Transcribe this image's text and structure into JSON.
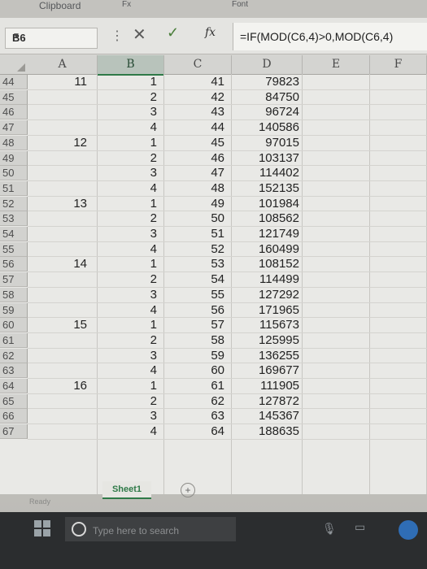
{
  "ribbon": {
    "clipboard_label": "Clipboard",
    "fx_group": "Fx",
    "font_group": "Font"
  },
  "formula_bar": {
    "name_box": "B6",
    "cancel_icon": "cancel-x-icon",
    "enter_icon": "check-icon",
    "fx_label": "fx",
    "formula": "=IF(MOD(C6,4)>0,MOD(C6,4)"
  },
  "columns": [
    "A",
    "B",
    "C",
    "D",
    "E",
    "F"
  ],
  "rows": [
    {
      "row": "44",
      "a": "11",
      "b": "1",
      "c": "41",
      "d": "79823"
    },
    {
      "row": "45",
      "a": "",
      "b": "2",
      "c": "42",
      "d": "84750"
    },
    {
      "row": "46",
      "a": "",
      "b": "3",
      "c": "43",
      "d": "96724"
    },
    {
      "row": "47",
      "a": "",
      "b": "4",
      "c": "44",
      "d": "140586"
    },
    {
      "row": "48",
      "a": "12",
      "b": "1",
      "c": "45",
      "d": "97015"
    },
    {
      "row": "49",
      "a": "",
      "b": "2",
      "c": "46",
      "d": "103137"
    },
    {
      "row": "50",
      "a": "",
      "b": "3",
      "c": "47",
      "d": "114402"
    },
    {
      "row": "51",
      "a": "",
      "b": "4",
      "c": "48",
      "d": "152135"
    },
    {
      "row": "52",
      "a": "13",
      "b": "1",
      "c": "49",
      "d": "101984"
    },
    {
      "row": "53",
      "a": "",
      "b": "2",
      "c": "50",
      "d": "108562"
    },
    {
      "row": "54",
      "a": "",
      "b": "3",
      "c": "51",
      "d": "121749"
    },
    {
      "row": "55",
      "a": "",
      "b": "4",
      "c": "52",
      "d": "160499"
    },
    {
      "row": "56",
      "a": "14",
      "b": "1",
      "c": "53",
      "d": "108152"
    },
    {
      "row": "57",
      "a": "",
      "b": "2",
      "c": "54",
      "d": "114499"
    },
    {
      "row": "58",
      "a": "",
      "b": "3",
      "c": "55",
      "d": "127292"
    },
    {
      "row": "59",
      "a": "",
      "b": "4",
      "c": "56",
      "d": "171965"
    },
    {
      "row": "60",
      "a": "15",
      "b": "1",
      "c": "57",
      "d": "115673"
    },
    {
      "row": "61",
      "a": "",
      "b": "2",
      "c": "58",
      "d": "125995"
    },
    {
      "row": "62",
      "a": "",
      "b": "3",
      "c": "59",
      "d": "136255"
    },
    {
      "row": "63",
      "a": "",
      "b": "4",
      "c": "60",
      "d": "169677"
    },
    {
      "row": "64",
      "a": "16",
      "b": "1",
      "c": "61",
      "d": "111905"
    },
    {
      "row": "65",
      "a": "",
      "b": "2",
      "c": "62",
      "d": "127872"
    },
    {
      "row": "66",
      "a": "",
      "b": "3",
      "c": "63",
      "d": "145367"
    },
    {
      "row": "67",
      "a": "",
      "b": "4",
      "c": "64",
      "d": "188635"
    }
  ],
  "sheet_tab": "Sheet1",
  "status": "Ready",
  "taskbar": {
    "search_placeholder": "Type here to search"
  },
  "colors": {
    "accent": "#2f7a48"
  }
}
